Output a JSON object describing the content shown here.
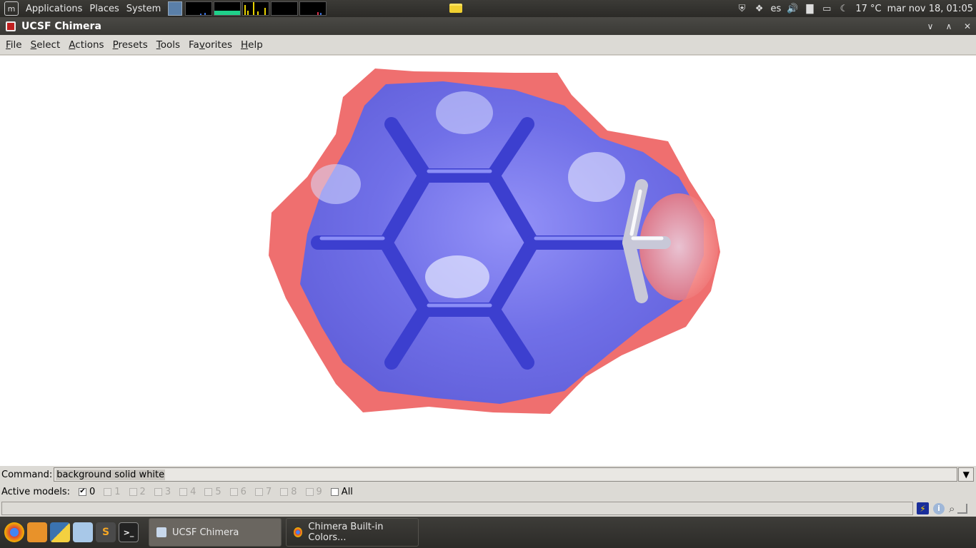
{
  "top_panel": {
    "menus": [
      "Applications",
      "Places",
      "System"
    ],
    "tray": {
      "keyboard_layout": "es",
      "temperature": "17 °C",
      "clock": "mar nov 18, 01:05"
    }
  },
  "window": {
    "title": "UCSF Chimera",
    "menubar": [
      {
        "label": "File",
        "mnemonic": 0
      },
      {
        "label": "Select",
        "mnemonic": 0
      },
      {
        "label": "Actions",
        "mnemonic": 0
      },
      {
        "label": "Presets",
        "mnemonic": 0
      },
      {
        "label": "Tools",
        "mnemonic": 0
      },
      {
        "label": "Favorites",
        "mnemonic": 2
      },
      {
        "label": "Help",
        "mnemonic": 0
      }
    ],
    "command": {
      "label": "Command:",
      "value": "background solid white"
    },
    "active_models": {
      "label": "Active models:",
      "models": [
        {
          "label": "0",
          "checked": true,
          "enabled": true
        },
        {
          "label": "1",
          "checked": false,
          "enabled": false
        },
        {
          "label": "2",
          "checked": false,
          "enabled": false
        },
        {
          "label": "3",
          "checked": false,
          "enabled": false
        },
        {
          "label": "4",
          "checked": false,
          "enabled": false
        },
        {
          "label": "5",
          "checked": false,
          "enabled": false
        },
        {
          "label": "6",
          "checked": false,
          "enabled": false
        },
        {
          "label": "7",
          "checked": false,
          "enabled": false
        },
        {
          "label": "8",
          "checked": false,
          "enabled": false
        },
        {
          "label": "9",
          "checked": false,
          "enabled": false
        },
        {
          "label": "All",
          "checked": false,
          "enabled": true
        }
      ]
    },
    "colors": {
      "surface_positive": "#5b62f0",
      "surface_negative": "#f07070",
      "bonds": "#3c3fcf",
      "background": "#ffffff"
    }
  },
  "taskbar": {
    "launchers": [
      "chrome-icon",
      "image-viewer-icon",
      "python-icon",
      "cube-icon",
      "sublime-text-icon",
      "terminal-icon"
    ],
    "tasks": [
      {
        "label": "UCSF Chimera",
        "active": true
      },
      {
        "label": "Chimera Built-in Colors...",
        "active": false
      }
    ]
  }
}
